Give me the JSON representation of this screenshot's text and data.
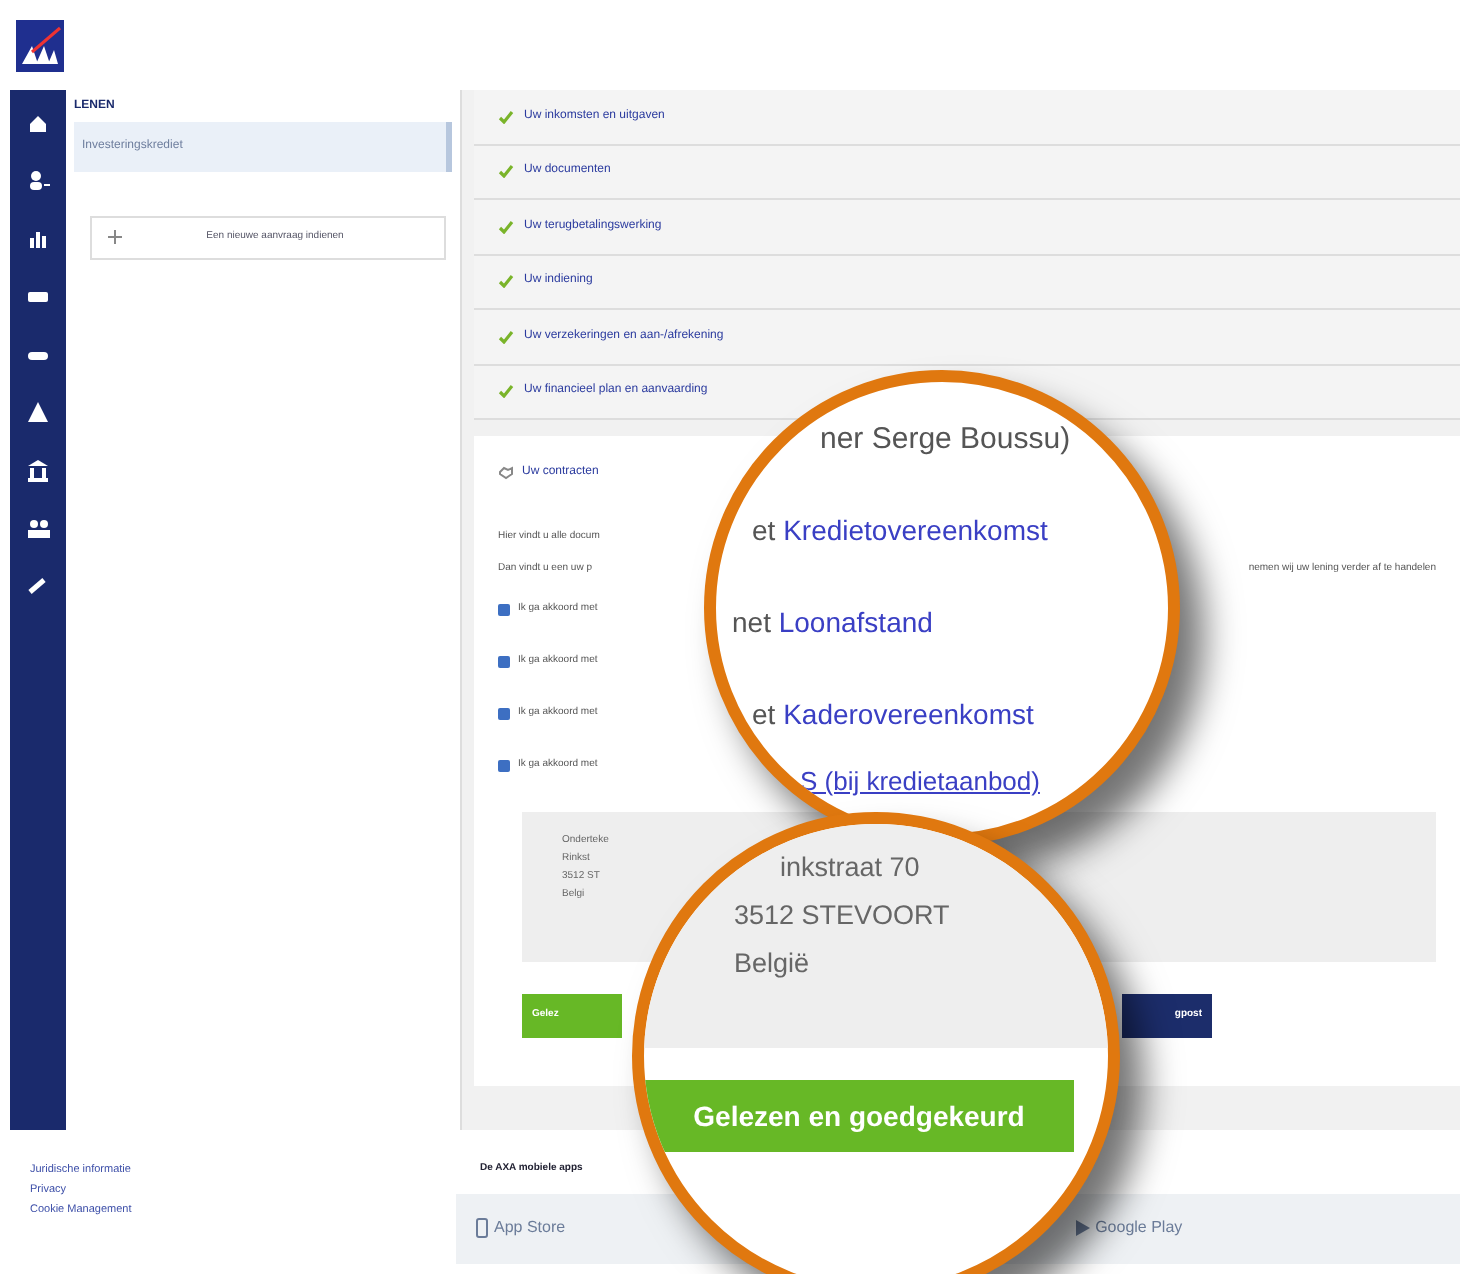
{
  "side_panel": {
    "heading": "LENEN",
    "items": [
      {
        "label": "Investeringskrediet",
        "selected": true
      }
    ],
    "add_button": "Een nieuwe aanvraag indienen"
  },
  "steps": [
    {
      "label": "Uw inkomsten en uitgaven",
      "done": true
    },
    {
      "label": "Uw documenten",
      "done": true
    },
    {
      "label": "Uw terugbetalingswerking",
      "done": true
    },
    {
      "label": "Uw indiening",
      "done": true
    },
    {
      "label": "Uw verzekeringen en aan-/afrekening",
      "done": true
    },
    {
      "label": "Uw financieel plan en aanvaarding",
      "done": true
    }
  ],
  "contracts": {
    "title": "Uw contracten",
    "intro": "Hier vindt u alle docum",
    "note_left": "Dan vindt u een uw p",
    "note_right": "nemen wij uw lening verder af te handelen",
    "checkboxes": [
      {
        "label": "Ik ga akkoord met",
        "checked": true
      },
      {
        "label": "Ik ga akkoord met",
        "checked": true
      },
      {
        "label": "Ik ga akkoord met",
        "checked": true
      },
      {
        "label": "Ik ga akkoord met",
        "checked": true
      }
    ],
    "address": [
      "Onderteke",
      "Rinkst",
      "3512 ST",
      "Belgi"
    ],
    "buttons": [
      {
        "label": "Gelez",
        "kind": "approve"
      },
      {
        "label": "gpost",
        "kind": "send"
      }
    ]
  },
  "magnifier_top": {
    "lines": [
      {
        "text": "ner Serge Boussu)"
      },
      {
        "prefix": "et ",
        "link": "Kredietovereenkomst"
      },
      {
        "prefix": "net ",
        "link": "Loonafstand"
      },
      {
        "prefix": "et ",
        "link": "Kaderovereenkomst"
      },
      {
        "link": "S (bij kredietaanbod)",
        "underline": true
      }
    ]
  },
  "magnifier_bottom": {
    "address": [
      "inkstraat 70",
      "3512 STEVOORT",
      "België"
    ],
    "button": "Gelezen en goedgekeurd"
  },
  "footer": {
    "links": [
      "Juridische informatie",
      "Privacy",
      "Cookie Management"
    ],
    "apps_title": "De AXA mobiele apps",
    "stores": [
      "App Store",
      "Google Play"
    ]
  }
}
